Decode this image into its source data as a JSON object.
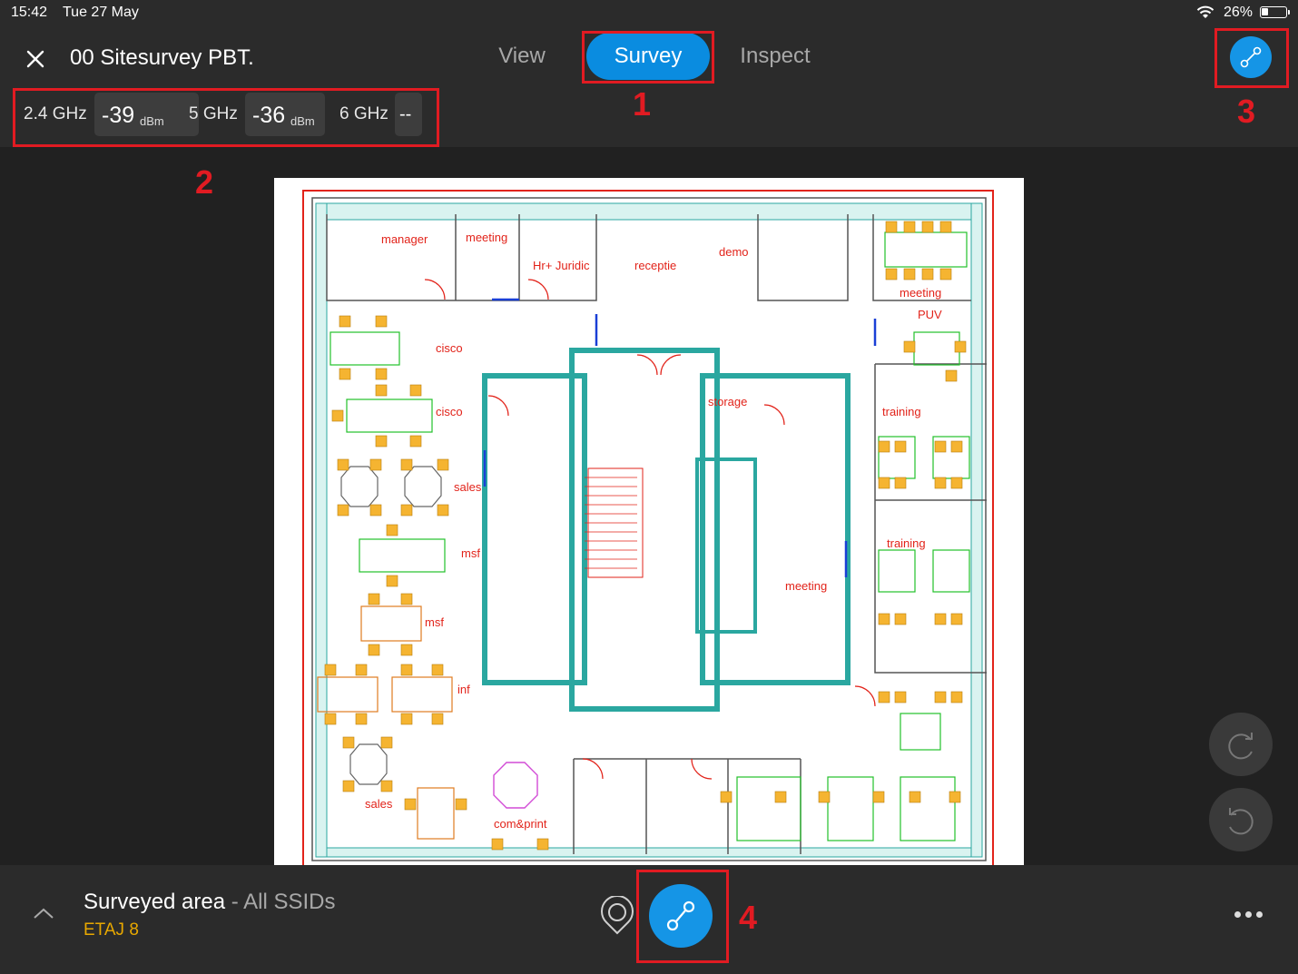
{
  "status_bar": {
    "time": "15:42",
    "date": "Tue 27 May",
    "battery": "26%"
  },
  "header": {
    "title": "00 Sitesurvey PBT.",
    "tabs": [
      {
        "label": "View",
        "active": false
      },
      {
        "label": "Survey",
        "active": true
      },
      {
        "label": "Inspect",
        "active": false
      }
    ]
  },
  "rssi": [
    {
      "band": "2.4 GHz",
      "value": "-39",
      "unit": "dBm"
    },
    {
      "band": "5 GHz",
      "value": "-36",
      "unit": "dBm"
    },
    {
      "band": "6 GHz",
      "value": "--",
      "unit": ""
    }
  ],
  "annotations": [
    "1",
    "2",
    "3",
    "4"
  ],
  "floorplan": {
    "rooms": [
      "manager",
      "meeting",
      "Hr+ Juridic",
      "receptie",
      "demo",
      "meeting",
      "PUV",
      "cisco",
      "cisco",
      "sales",
      "msf",
      "msf",
      "inf",
      "sales",
      "com&print",
      "storage",
      "meeting",
      "training",
      "training"
    ]
  },
  "bottom": {
    "title": "Surveyed area",
    "subtitle": " - All SSIDs",
    "floor": "ETAJ 8"
  },
  "colors": {
    "accent": "#1595e6",
    "annotation": "#e11b22",
    "floor_label": "#e8a800"
  },
  "icons": [
    "close-icon",
    "route-icon",
    "redo-icon",
    "undo-icon",
    "chevron-up-icon",
    "location-pin-icon",
    "more-icon",
    "wifi-icon",
    "battery-icon"
  ]
}
